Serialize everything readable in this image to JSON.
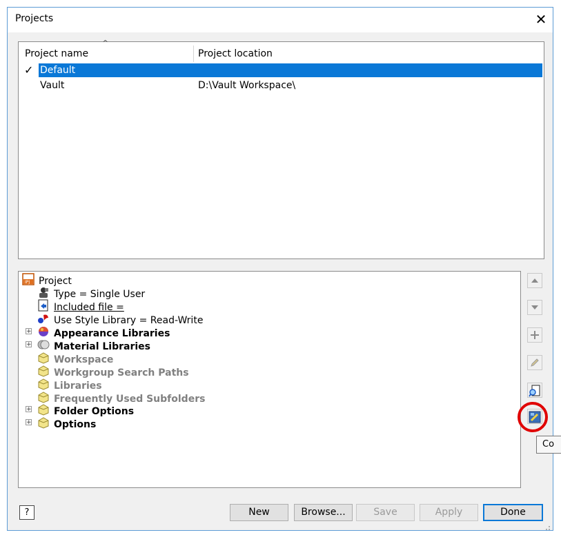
{
  "window": {
    "title": "Projects",
    "close_glyph": "✕"
  },
  "project_list": {
    "columns": [
      "Project name",
      "Project location"
    ],
    "sort_glyph": "^",
    "rows": [
      {
        "name": "Default",
        "location": "",
        "active": true,
        "selected": true
      },
      {
        "name": "Vault",
        "location": "D:\\Vault Workspace\\",
        "active": false,
        "selected": false
      }
    ],
    "check_glyph": "✓"
  },
  "tree": {
    "root": "Project",
    "items": [
      {
        "label": "Type = Single User",
        "icon": "user-type-icon"
      },
      {
        "label": "Included file =",
        "icon": "included-file-icon"
      },
      {
        "label": "Use Style Library = Read-Write",
        "icon": "style-library-icon"
      },
      {
        "label": "Appearance Libraries",
        "icon": "appearance-library-icon"
      },
      {
        "label": "Material Libraries",
        "icon": "material-library-icon"
      },
      {
        "label": "Workspace",
        "icon": "folder-icon"
      },
      {
        "label": "Workgroup Search Paths",
        "icon": "folder-icon"
      },
      {
        "label": "Libraries",
        "icon": "folder-icon"
      },
      {
        "label": "Frequently Used Subfolders",
        "icon": "folder-icon"
      },
      {
        "label": "Folder Options",
        "icon": "folder-icon"
      },
      {
        "label": "Options",
        "icon": "folder-icon"
      }
    ],
    "expander_glyph": "+"
  },
  "side_buttons": [
    "move-up",
    "move-down",
    "add",
    "edit",
    "find",
    "configure"
  ],
  "tooltip": "Co",
  "buttons": {
    "help": "?",
    "new": "New",
    "browse": "Browse...",
    "save": "Save",
    "apply": "Apply",
    "done": "Done"
  },
  "colors": {
    "selection": "#0a78d7",
    "highlight_circle": "#e00000",
    "window_border": "#5b9bd5"
  }
}
